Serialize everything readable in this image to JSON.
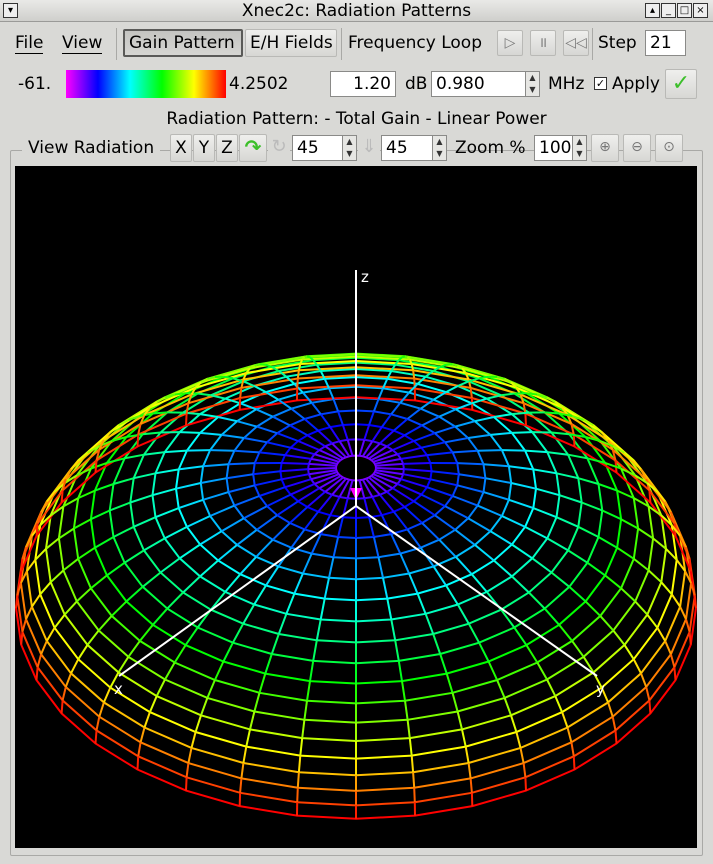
{
  "window": {
    "title": "Xnec2c: Radiation Patterns"
  },
  "menu": {
    "file": "File",
    "view": "View"
  },
  "toolbar": {
    "gain_pattern": "Gain Pattern",
    "eh_fields": "E/H Fields",
    "frequency_loop": "Frequency Loop",
    "step_label": "Step",
    "step_value": "21"
  },
  "scale": {
    "min": "-61.",
    "max": "4.2502",
    "db_value": "1.20",
    "db_label": "dB",
    "freq_value": "0.980",
    "freq_unit": "MHz",
    "apply_label": "Apply",
    "apply_checked": true
  },
  "pattern_title": "Radiation Pattern: - Total Gain - Linear Power",
  "view": {
    "label": "View Radiation",
    "x": "X",
    "y": "Y",
    "z": "Z",
    "rotate_value": "45",
    "incline_value": "45",
    "zoom_label": "Zoom %",
    "zoom_value": "100"
  },
  "axes": {
    "x": "x",
    "y": "y",
    "z": "z"
  },
  "colors": {
    "canvas_bg": "#000000",
    "axis": "#ffffff",
    "apply_ok": "#3cbf2a",
    "gradient": [
      "#ff00ff",
      "#0000ff",
      "#00ffff",
      "#00ff00",
      "#ffff00",
      "#ff0000"
    ]
  },
  "icons": {
    "window_menu": "window-menu-icon",
    "play": "play-icon",
    "pause": "pause-icon",
    "rewind": "rewind-icon",
    "apply_ok": "checkmark-icon",
    "rotate_cw": "rotate-clockwise-icon",
    "rotate_ccw": "rotate-counterclockwise-icon",
    "incline": "incline-arrow-icon",
    "zoom_in": "zoom-in-icon",
    "zoom_out": "zoom-out-icon",
    "zoom_reset": "zoom-reset-icon"
  }
}
